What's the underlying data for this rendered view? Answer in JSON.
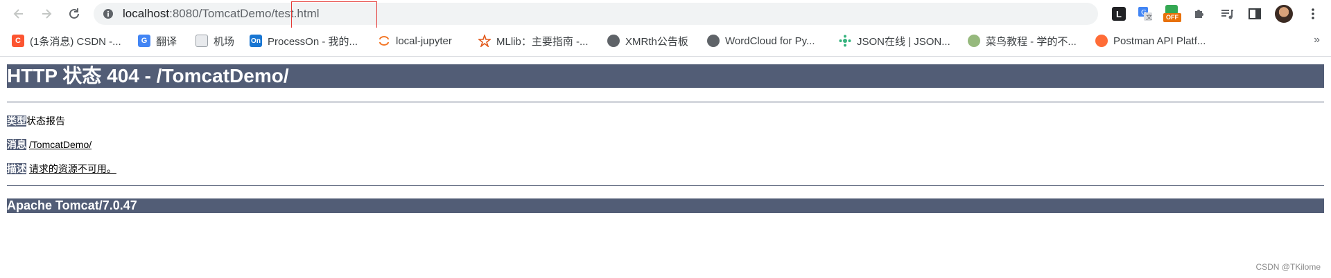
{
  "browser": {
    "url_host": "localhost",
    "url_path": ":8080/TomcatDemo/test.html",
    "extensions": [
      "leanote-extension-icon",
      "google-translate-icon",
      "off-badge-extension-icon",
      "puzzle-extensions-icon",
      "media-playlist-icon",
      "side-panel-icon",
      "profile-avatar",
      "menu-kebab-icon"
    ],
    "off_badge": "OFF",
    "leanote_letter": "L"
  },
  "bookmarks": [
    {
      "label": "(1条消息) CSDN -...",
      "icon": "csdn-icon",
      "icon_char": "C",
      "color": "#fc5531"
    },
    {
      "label": "翻译",
      "icon": "google-translate-icon",
      "icon_char": "G",
      "color": "#4285f4"
    },
    {
      "label": "机场",
      "icon": "page-icon",
      "icon_char": "",
      "color": "#9aa0a6"
    },
    {
      "label": "ProcessOn - 我的...",
      "icon": "processon-icon",
      "icon_char": "On",
      "color": "#1976d2"
    },
    {
      "label": "local-jupyter",
      "icon": "jupyter-icon",
      "icon_char": "",
      "color": "#f37626"
    },
    {
      "label": "MLlib：主要指南 -...",
      "icon": "spark-icon",
      "icon_char": "",
      "color": "#e25a1c"
    },
    {
      "label": "XMRth公告板",
      "icon": "globe-icon",
      "icon_char": "",
      "color": "#5f6368"
    },
    {
      "label": "WordCloud for Py...",
      "icon": "globe-icon",
      "icon_char": "",
      "color": "#5f6368"
    },
    {
      "label": "JSON在线 | JSON...",
      "icon": "json-icon",
      "icon_char": "",
      "color": "#36b37e"
    },
    {
      "label": "菜鸟教程 - 学的不...",
      "icon": "runoob-icon",
      "icon_char": "",
      "color": "#96b97d"
    },
    {
      "label": "Postman API Platf...",
      "icon": "postman-icon",
      "icon_char": "",
      "color": "#ff6c37"
    }
  ],
  "page": {
    "heading": "HTTP 状态 404 - /TomcatDemo/",
    "type_label": "类型",
    "type_value": "状态报告",
    "message_label": "消息",
    "message_value": "/TomcatDemo/",
    "description_label": "描述",
    "description_value": "请求的资源不可用。",
    "footer": "Apache Tomcat/7.0.47"
  },
  "watermark": "CSDN @TKilome",
  "colors": {
    "tomcat_bar": "#525d76",
    "highlight_box": "#e53935"
  }
}
